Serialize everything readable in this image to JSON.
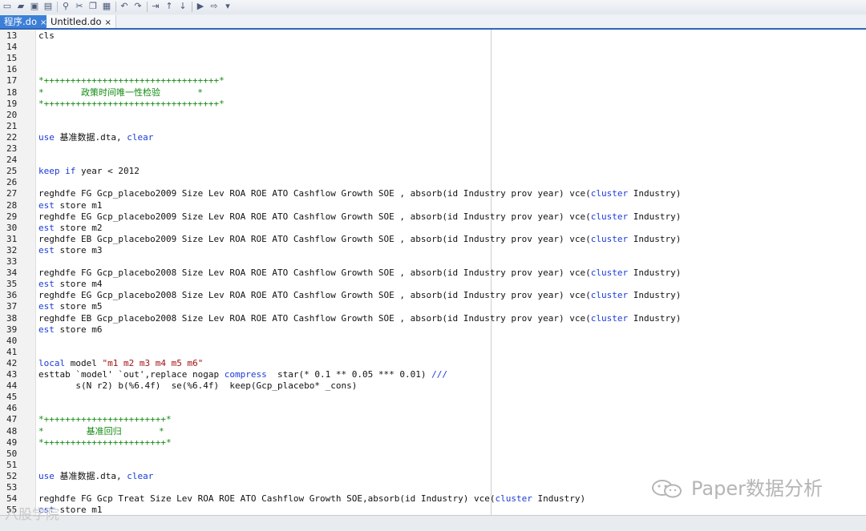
{
  "tabs": [
    {
      "label": "程序.do",
      "close": "×",
      "active": true
    },
    {
      "label": "Untitled.do",
      "close": "×",
      "active": false
    }
  ],
  "toolbar_icons": [
    "new-icon",
    "open-icon",
    "save-icon",
    "print-icon",
    "find-icon",
    "cut-icon",
    "copy-icon",
    "paste-icon",
    "undo-icon",
    "redo-icon",
    "indent-icon",
    "move-up-icon",
    "move-down-icon",
    "run-icon",
    "execute-icon",
    "more-icon"
  ],
  "lines": [
    {
      "n": "13",
      "code": [
        [
          "cls",
          "p"
        ]
      ]
    },
    {
      "n": "14",
      "code": []
    },
    {
      "n": "15",
      "code": []
    },
    {
      "n": "16",
      "code": []
    },
    {
      "n": "17",
      "code": [
        [
          "*+++++++++++++++++++++++++++++++++*",
          "c"
        ]
      ]
    },
    {
      "n": "18",
      "code": [
        [
          "*       政策时间唯一性检验       *",
          "c"
        ]
      ]
    },
    {
      "n": "19",
      "code": [
        [
          "*+++++++++++++++++++++++++++++++++*",
          "c"
        ]
      ]
    },
    {
      "n": "20",
      "code": []
    },
    {
      "n": "21",
      "code": []
    },
    {
      "n": "22",
      "code": [
        [
          "use",
          "k"
        ],
        [
          " 基准数据.dta, ",
          "p"
        ],
        [
          "clear",
          "k"
        ]
      ]
    },
    {
      "n": "23",
      "code": []
    },
    {
      "n": "24",
      "code": []
    },
    {
      "n": "25",
      "code": [
        [
          "keep",
          "k"
        ],
        [
          " ",
          "p"
        ],
        [
          "if",
          "k"
        ],
        [
          " year < 2012",
          "p"
        ]
      ]
    },
    {
      "n": "26",
      "code": []
    },
    {
      "n": "27",
      "code": [
        [
          "reghdfe FG Gcp_placebo2009 Size Lev ROA ROE ATO Cashflow Growth SOE , absorb(id Industry prov year) vce(",
          "p"
        ],
        [
          "cluster",
          "k"
        ],
        [
          " Industry)",
          "p"
        ]
      ]
    },
    {
      "n": "28",
      "code": [
        [
          "est",
          "k"
        ],
        [
          " store m1",
          "p"
        ]
      ]
    },
    {
      "n": "29",
      "code": [
        [
          "reghdfe EG Gcp_placebo2009 Size Lev ROA ROE ATO Cashflow Growth SOE , absorb(id Industry prov year) vce(",
          "p"
        ],
        [
          "cluster",
          "k"
        ],
        [
          " Industry)",
          "p"
        ]
      ]
    },
    {
      "n": "30",
      "code": [
        [
          "est",
          "k"
        ],
        [
          " store m2",
          "p"
        ]
      ]
    },
    {
      "n": "31",
      "code": [
        [
          "reghdfe EB Gcp_placebo2009 Size Lev ROA ROE ATO Cashflow Growth SOE , absorb(id Industry prov year) vce(",
          "p"
        ],
        [
          "cluster",
          "k"
        ],
        [
          " Industry)",
          "p"
        ]
      ]
    },
    {
      "n": "32",
      "code": [
        [
          "est",
          "k"
        ],
        [
          " store m3",
          "p"
        ]
      ]
    },
    {
      "n": "33",
      "code": []
    },
    {
      "n": "34",
      "code": [
        [
          "reghdfe FG Gcp_placebo2008 Size Lev ROA ROE ATO Cashflow Growth SOE , absorb(id Industry prov year) vce(",
          "p"
        ],
        [
          "cluster",
          "k"
        ],
        [
          " Industry)",
          "p"
        ]
      ]
    },
    {
      "n": "35",
      "code": [
        [
          "est",
          "k"
        ],
        [
          " store m4",
          "p"
        ]
      ]
    },
    {
      "n": "36",
      "code": [
        [
          "reghdfe EG Gcp_placebo2008 Size Lev ROA ROE ATO Cashflow Growth SOE , absorb(id Industry prov year) vce(",
          "p"
        ],
        [
          "cluster",
          "k"
        ],
        [
          " Industry)",
          "p"
        ]
      ]
    },
    {
      "n": "37",
      "code": [
        [
          "est",
          "k"
        ],
        [
          " store m5",
          "p"
        ]
      ]
    },
    {
      "n": "38",
      "code": [
        [
          "reghdfe EB Gcp_placebo2008 Size Lev ROA ROE ATO Cashflow Growth SOE , absorb(id Industry prov year) vce(",
          "p"
        ],
        [
          "cluster",
          "k"
        ],
        [
          " Industry)",
          "p"
        ]
      ]
    },
    {
      "n": "39",
      "code": [
        [
          "est",
          "k"
        ],
        [
          " store m6",
          "p"
        ]
      ]
    },
    {
      "n": "40",
      "code": []
    },
    {
      "n": "41",
      "code": []
    },
    {
      "n": "42",
      "code": [
        [
          "local",
          "k"
        ],
        [
          " model ",
          "p"
        ],
        [
          "\"m1 m2 m3 m4 m5 m6\"",
          "s"
        ]
      ]
    },
    {
      "n": "43",
      "code": [
        [
          "esttab `model' `out',replace nogap ",
          "p"
        ],
        [
          "compress",
          "k"
        ],
        [
          "  star(* 0.1 ** 0.05 *** 0.01) ",
          "p"
        ],
        [
          "///",
          "k"
        ]
      ]
    },
    {
      "n": "44",
      "code": [
        [
          "       s(N r2) b(%6.4f)  se(%6.4f)  keep(Gcp_placebo* _cons)",
          "p"
        ]
      ]
    },
    {
      "n": "45",
      "code": []
    },
    {
      "n": "46",
      "code": []
    },
    {
      "n": "47",
      "code": [
        [
          "*+++++++++++++++++++++++*",
          "c"
        ]
      ]
    },
    {
      "n": "48",
      "code": [
        [
          "*        基准回归       *",
          "c"
        ]
      ]
    },
    {
      "n": "49",
      "code": [
        [
          "*+++++++++++++++++++++++*",
          "c"
        ]
      ]
    },
    {
      "n": "50",
      "code": []
    },
    {
      "n": "51",
      "code": []
    },
    {
      "n": "52",
      "code": [
        [
          "use",
          "k"
        ],
        [
          " 基准数据.dta, ",
          "p"
        ],
        [
          "clear",
          "k"
        ]
      ]
    },
    {
      "n": "53",
      "code": []
    },
    {
      "n": "54",
      "code": [
        [
          "reghdfe FG Gcp Treat Size Lev ROA ROE ATO Cashflow Growth SOE,absorb(id Industry) vce(",
          "p"
        ],
        [
          "cluster",
          "k"
        ],
        [
          " Industry)",
          "p"
        ]
      ]
    },
    {
      "n": "55",
      "code": [
        [
          "est",
          "k"
        ],
        [
          " store m1",
          "p"
        ]
      ]
    }
  ],
  "watermark": "Paper数据分析",
  "watermark2": "八股学院",
  "colors": {
    "keyword": "#1a3bd6",
    "comment": "#138a13",
    "string": "#a11010",
    "tab_active": "#3c7fd6"
  }
}
